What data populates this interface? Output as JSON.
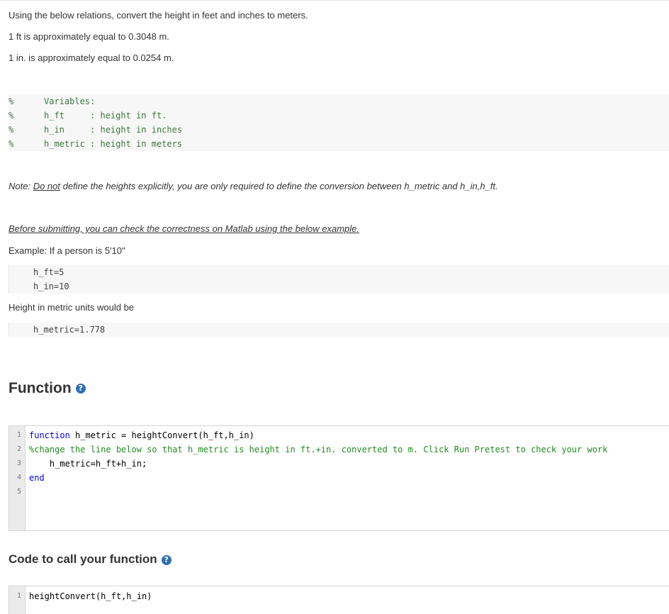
{
  "instructions": {
    "line1": "Using the below relations, convert the height in feet and inches to meters.",
    "line2": "1 ft is approximately equal to 0.3048 m.",
    "line3": "1 in. is approximately equal to 0.0254 m."
  },
  "variables_block": [
    {
      "pct": "%",
      "text": "Variables:"
    },
    {
      "pct": "%",
      "text": "h_ft     : height in ft."
    },
    {
      "pct": "%",
      "text": "h_in     : height in inches"
    },
    {
      "pct": "%",
      "text": "h_metric : height in meters"
    }
  ],
  "note": {
    "prefix": "Note: ",
    "underlined": "Do not",
    "rest": " define the heights explicitly, you are only required to define the conversion between h_metric and h_in,h_ft."
  },
  "before_submitting": "Before submitting, you can check the correctness on Matlab using the below example.",
  "example_label": "Example: If a person is 5'10\"",
  "example_code": [
    "h_ft=5",
    "h_in=10"
  ],
  "metric_label": "Height in metric units would be",
  "metric_code": "h_metric=1.778",
  "function_section": {
    "title": "Function",
    "help_icon": "?",
    "line_numbers": [
      "1",
      "2",
      "3",
      "4",
      "5"
    ],
    "code": {
      "l1_kw": "function",
      "l1_rest": " h_metric = heightConvert(h_ft,h_in)",
      "l2": "%change the line below so that h_metric is height in ft.+in. converted to m. Click Run Pretest to check your work",
      "l3": "    h_metric=h_ft+h_in;",
      "l4_kw": "end"
    }
  },
  "call_section": {
    "title": "Code to call your function",
    "help_icon": "?",
    "line_number": "1",
    "code": "heightConvert(h_ft,h_in)"
  }
}
